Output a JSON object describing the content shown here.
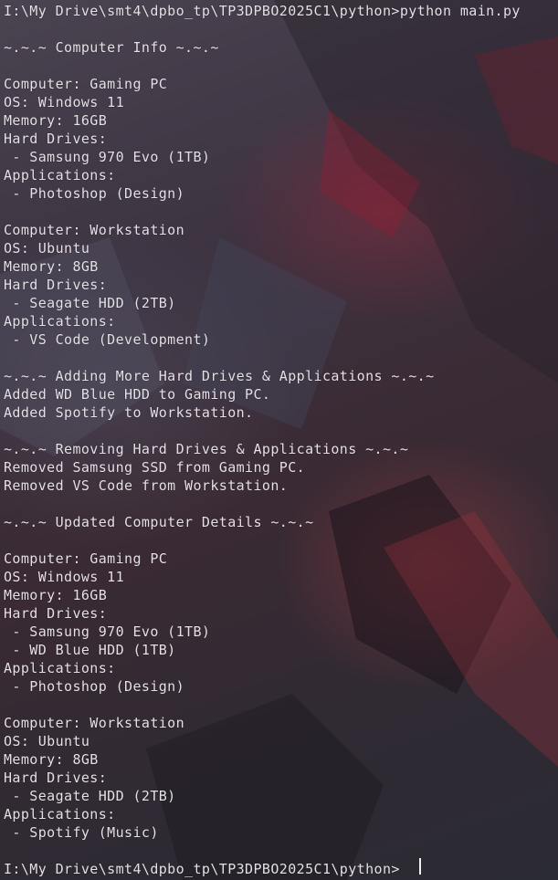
{
  "terminal": {
    "lines": [
      "I:\\My Drive\\smt4\\dpbo_tp\\TP3DPBO2025C1\\python>python main.py",
      "",
      "~.~.~ Computer Info ~.~.~",
      "",
      "Computer: Gaming PC",
      "OS: Windows 11",
      "Memory: 16GB",
      "Hard Drives:",
      " - Samsung 970 Evo (1TB)",
      "Applications:",
      " - Photoshop (Design)",
      "",
      "Computer: Workstation",
      "OS: Ubuntu",
      "Memory: 8GB",
      "Hard Drives:",
      " - Seagate HDD (2TB)",
      "Applications:",
      " - VS Code (Development)",
      "",
      "~.~.~ Adding More Hard Drives & Applications ~.~.~",
      "Added WD Blue HDD to Gaming PC.",
      "Added Spotify to Workstation.",
      "",
      "~.~.~ Removing Hard Drives & Applications ~.~.~",
      "Removed Samsung SSD from Gaming PC.",
      "Removed VS Code from Workstation.",
      "",
      "~.~.~ Updated Computer Details ~.~.~",
      "",
      "Computer: Gaming PC",
      "OS: Windows 11",
      "Memory: 16GB",
      "Hard Drives:",
      " - Samsung 970 Evo (1TB)",
      " - WD Blue HDD (1TB)",
      "Applications:",
      " - Photoshop (Design)",
      "",
      "Computer: Workstation",
      "OS: Ubuntu",
      "Memory: 8GB",
      "Hard Drives:",
      " - Seagate HDD (2TB)",
      "Applications:",
      " - Spotify (Music)",
      "",
      "I:\\My Drive\\smt4\\dpbo_tp\\TP3DPBO2025C1\\python>"
    ]
  }
}
